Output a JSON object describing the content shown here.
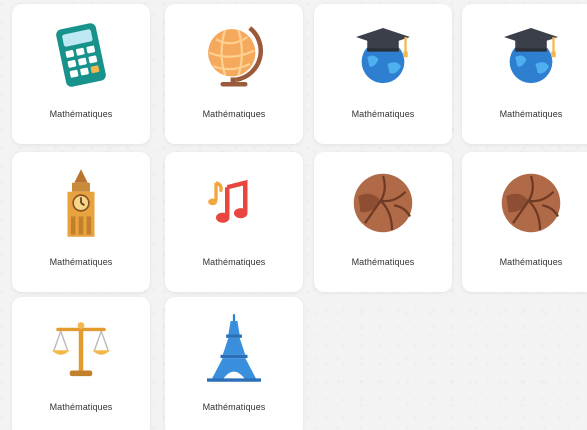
{
  "cards": [
    {
      "label": "Mathématiques",
      "icon": "calculator-icon"
    },
    {
      "label": "Mathématiques",
      "icon": "globe-icon"
    },
    {
      "label": "Mathématiques",
      "icon": "graduation-globe-icon"
    },
    {
      "label": "Mathématiques",
      "icon": "graduation-globe-icon"
    },
    {
      "label": "Mathématiques",
      "icon": "big-ben-icon"
    },
    {
      "label": "Mathématiques",
      "icon": "music-notes-icon"
    },
    {
      "label": "Mathématiques",
      "icon": "football-icon"
    },
    {
      "label": "Mathématiques",
      "icon": "football-icon"
    },
    {
      "label": "Mathématiques",
      "icon": "scales-icon"
    },
    {
      "label": "Mathématiques",
      "icon": "eiffel-tower-icon"
    }
  ],
  "colors": {
    "background": "#f3f3f4",
    "card": "#ffffff",
    "label_text": "#333333"
  }
}
